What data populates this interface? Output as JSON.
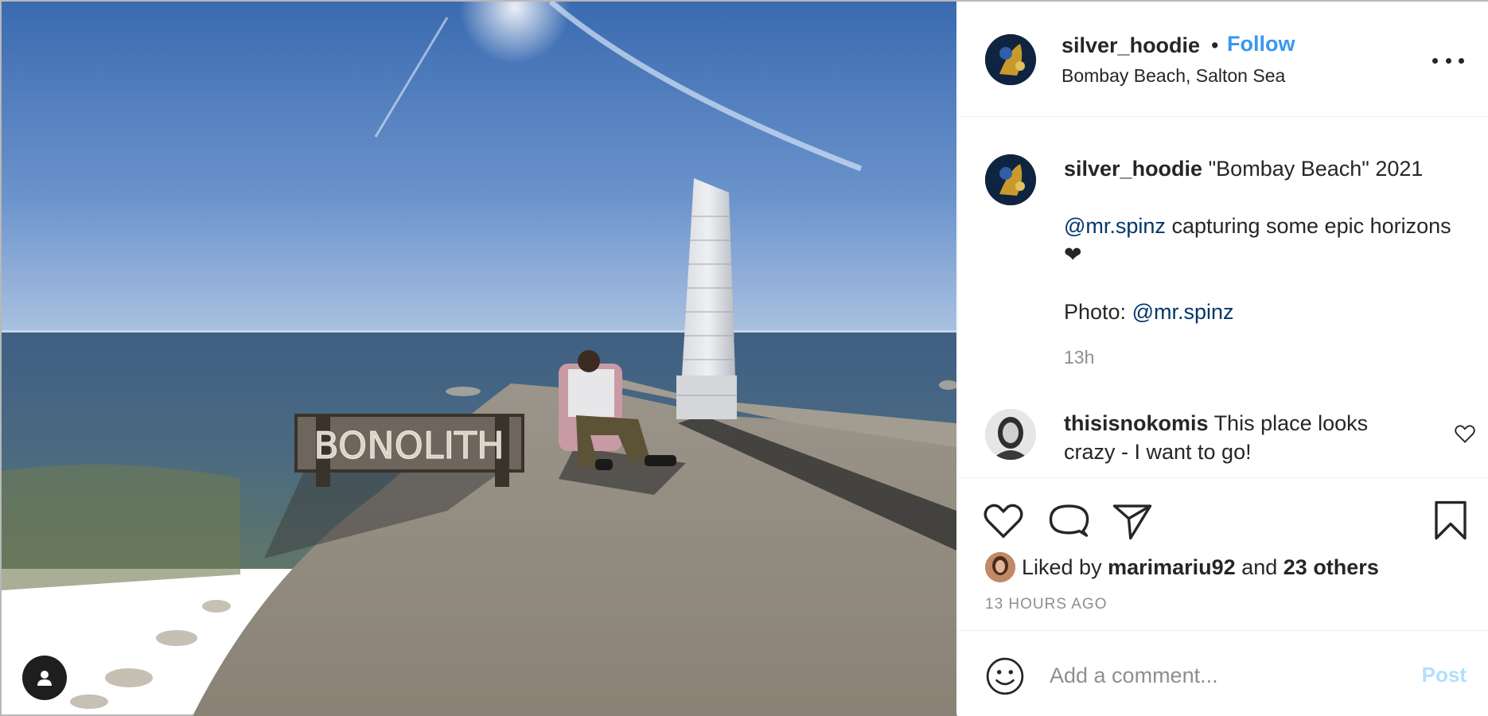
{
  "photo": {
    "sign_text": "BONOLITH",
    "tag_icon": "person-icon"
  },
  "post": {
    "username": "silver_hoodie",
    "separator": "•",
    "follow_label": "Follow",
    "location": "Bombay Beach, Salton Sea",
    "more_icon": "more-icon"
  },
  "caption": {
    "username": "silver_hoodie",
    "title": "\"Bombay Beach\" 2021",
    "mention1": "@mr.spinz",
    "line2": "capturing some epic horizons ❤",
    "photo_label": "Photo:",
    "mention2": "@mr.spinz",
    "time": "13h"
  },
  "comment": {
    "username": "thisisnokomis",
    "text": "This place looks crazy - I want to go!"
  },
  "likes": {
    "prefix": "Liked by",
    "user": "marimariu92",
    "and": "and",
    "others": "23 others"
  },
  "timestamp": "13 HOURS AGO",
  "add_comment": {
    "placeholder": "Add a comment...",
    "post_label": "Post"
  },
  "colors": {
    "accent": "#3897f0",
    "mention": "#00376b",
    "post_disabled": "#b2dffc",
    "muted": "#8e8e8e"
  }
}
